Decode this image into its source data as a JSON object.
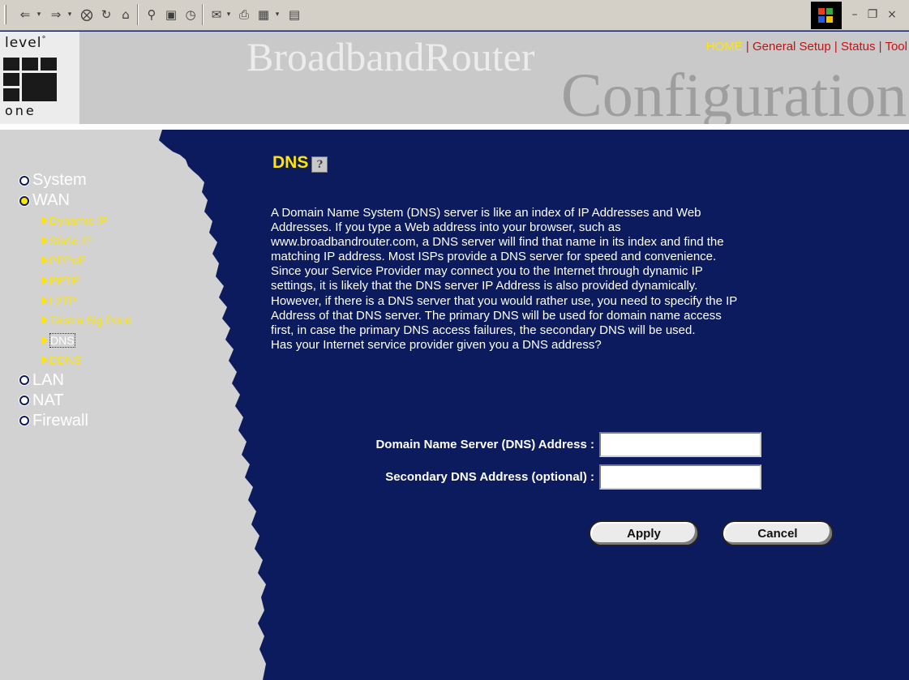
{
  "browser_toolbar": {
    "icons": [
      "back-arrow-icon",
      "dropdown-icon",
      "forward-arrow-icon",
      "dropdown-icon",
      "stop-icon",
      "refresh-icon",
      "home-icon",
      "search-icon",
      "favorites-icon",
      "history-icon",
      "mail-icon",
      "print-icon",
      "edit-icon",
      "discuss-icon"
    ],
    "window_controls": [
      "minimize-icon",
      "restore-icon",
      "close-icon"
    ]
  },
  "header": {
    "logo_top": "level",
    "logo_sup": "°",
    "logo_bottom": "one",
    "brand": "BroadbandRouter",
    "subtitle": "Configuration",
    "nav": {
      "home": "HOME",
      "sep": " | ",
      "general_setup": "General Setup",
      "status": "Status",
      "tools": "Tool"
    },
    "home_color": "#ffe600",
    "nav_color": "#c81010"
  },
  "sidebar": {
    "items": [
      {
        "label": "System"
      },
      {
        "label": "WAN",
        "open": true
      },
      {
        "label": "LAN"
      },
      {
        "label": "NAT"
      },
      {
        "label": "Firewall"
      }
    ],
    "wan_sub": [
      {
        "label": "Dynamic IP"
      },
      {
        "label": "Static IP"
      },
      {
        "label": "PPPoE"
      },
      {
        "label": "PPTP"
      },
      {
        "label": "L2TP"
      },
      {
        "label": "Telstra Big Pond"
      },
      {
        "label": "DNS",
        "selected": true
      },
      {
        "label": "DDNS"
      }
    ],
    "accent_color": "#ffe600"
  },
  "main": {
    "title": "DNS",
    "help_icon": "help-icon",
    "description_lines": [
      "A Domain Name System (DNS) server is like an index of IP Addresses and Web",
      "Addresses. If you type a Web address into your browser, such as",
      "www.broadbandrouter.com, a DNS server will find that name in its index and find the",
      "matching IP address. Most ISPs provide a DNS server for speed and convenience.",
      "Since your Service Provider may connect you to the Internet through dynamic IP",
      "settings, it is likely that the DNS server IP Address is also provided dynamically.",
      "However, if there is a DNS server that you would rather use, you need to specify the IP",
      "Address of that DNS server. The primary DNS will be used for domain name access",
      "first, in case the primary DNS access failures, the secondary DNS will be used.",
      "Has your Internet service provider given you a DNS address?"
    ],
    "fields": {
      "primary_label": "Domain Name Server (DNS) Address :",
      "primary_value": "",
      "secondary_label": "Secondary DNS Address (optional) :",
      "secondary_value": ""
    },
    "buttons": {
      "apply": "Apply",
      "cancel": "Cancel"
    },
    "background_color": "#0c1a5e"
  }
}
